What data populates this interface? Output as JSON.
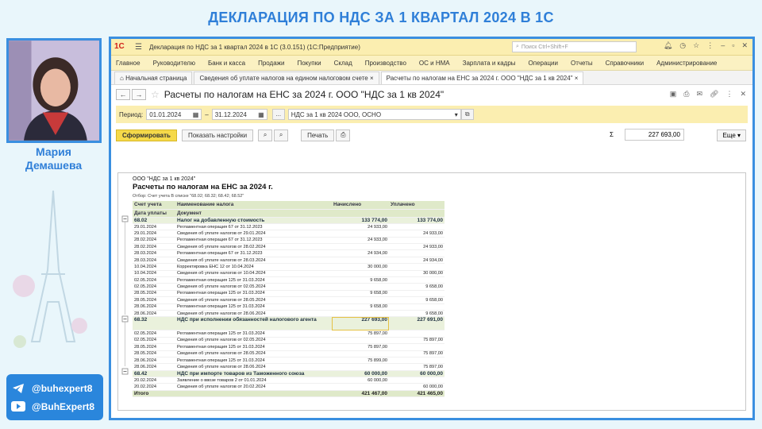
{
  "heading": "ДЕКЛАРАЦИЯ ПО НДС ЗА 1 КВАРТАЛ 2024 В 1С",
  "presenter": {
    "first_name": "Мария",
    "last_name": "Демашева"
  },
  "social": {
    "telegram": "@buhexpert8",
    "youtube": "@BuhExpert8"
  },
  "app": {
    "logo": "1С",
    "title": "Декларация по НДС за 1 квартал 2024 в 1С (3.0.151)  (1С:Предприятие)",
    "search_placeholder": "Поиск Ctrl+Shift+F"
  },
  "menu": [
    "Главное",
    "Руководителю",
    "Банк и касса",
    "Продажи",
    "Покупки",
    "Склад",
    "Производство",
    "ОС и НМА",
    "Зарплата и кадры",
    "Операции",
    "Отчеты",
    "Справочники",
    "Администрирование"
  ],
  "tabs": {
    "home": "Начальная страница",
    "t1": "Сведения об уплате налогов на едином налоговом счете",
    "t1_close": "×",
    "t2": "Расчеты по налогам на ЕНС за 2024 г. ООО \"НДС за 1 кв 2024\"",
    "t2_close": "×"
  },
  "form": {
    "title": "Расчеты по налогам на ЕНС за 2024 г. ООО \"НДС за 1 кв 2024\"",
    "period_label": "Период:",
    "date_from": "01.01.2024",
    "date_to": "31.12.2024",
    "dash": "–",
    "dots": "...",
    "org": "НДС за 1 кв 2024 ООО, ОСНО",
    "btn_generate": "Сформировать",
    "btn_settings": "Показать настройки",
    "btn_print": "Печать",
    "sum_symbol": "Σ",
    "sum_value": "227 693,00",
    "btn_more": "Еще ▾"
  },
  "report": {
    "org": "ООО \"НДС за 1 кв 2024\"",
    "title": "Расчеты по налогам на ЕНС за 2024 г.",
    "filter": "Отбор: Счет учета В списке \"68.02; 68.32; 68.42; 68.52\"",
    "headers": {
      "h1": "Счет учета",
      "h2": "Наименование налога",
      "h3": "Начислено",
      "h4": "Уплачено",
      "h5": "Дата уплаты",
      "h6": "Документ"
    },
    "rows": [
      {
        "type": "grp",
        "a": "68.02",
        "b": "Налог на добавленную стоимость",
        "c": "133 774,00",
        "d": "133 774,00"
      },
      {
        "type": "row",
        "a": "29.01.2024",
        "b": "Регламентная операция 67 от 31.12.2023",
        "c": "24 933,00",
        "d": ""
      },
      {
        "type": "row",
        "a": "29.01.2024",
        "b": "Сведения об уплате налогов от 29.01.2024",
        "c": "",
        "d": "24 933,00"
      },
      {
        "type": "row",
        "a": "28.02.2024",
        "b": "Регламентная операция 67 от 31.12.2023",
        "c": "24 933,00",
        "d": ""
      },
      {
        "type": "row",
        "a": "28.02.2024",
        "b": "Сведения об уплате налогов от 28.02.2024",
        "c": "",
        "d": "24 933,00"
      },
      {
        "type": "row",
        "a": "28.03.2024",
        "b": "Регламентная операция 67 от 31.12.2023",
        "c": "24 934,00",
        "d": ""
      },
      {
        "type": "row",
        "a": "28.03.2024",
        "b": "Сведения об уплате налогов от 28.03.2024",
        "c": "",
        "d": "24 934,00"
      },
      {
        "type": "row",
        "a": "10.04.2024",
        "b": "Корректировка ЕНС 12 от 10.04.2024",
        "c": "30 000,00",
        "d": ""
      },
      {
        "type": "row",
        "a": "10.04.2024",
        "b": "Сведения об уплате налогов от 10.04.2024",
        "c": "",
        "d": "30 000,00"
      },
      {
        "type": "row",
        "a": "02.05.2024",
        "b": "Регламентная операция 125 от 31.03.2024",
        "c": "9 658,00",
        "d": ""
      },
      {
        "type": "row",
        "a": "02.05.2024",
        "b": "Сведения об уплате налогов от 02.05.2024",
        "c": "",
        "d": "9 658,00"
      },
      {
        "type": "row",
        "a": "28.05.2024",
        "b": "Регламентная операция 125 от 31.03.2024",
        "c": "9 658,00",
        "d": ""
      },
      {
        "type": "row",
        "a": "28.05.2024",
        "b": "Сведения об уплате налогов от 28.05.2024",
        "c": "",
        "d": "9 658,00"
      },
      {
        "type": "row",
        "a": "28.06.2024",
        "b": "Регламентная операция 125 от 31.03.2024",
        "c": "9 658,00",
        "d": ""
      },
      {
        "type": "row",
        "a": "28.06.2024",
        "b": "Сведения об уплате налогов от 28.06.2024",
        "c": "",
        "d": "9 658,00"
      },
      {
        "type": "grp2",
        "a": "68.32",
        "b": "НДС при исполнении обязанностей налогового агента",
        "c": "227 693,00",
        "d": "227 691,00"
      },
      {
        "type": "row",
        "a": "02.05.2024",
        "b": "Регламентная операция 125 от 31.03.2024",
        "c": "75 897,00",
        "d": ""
      },
      {
        "type": "row",
        "a": "02.05.2024",
        "b": "Сведения об уплате налогов от 02.05.2024",
        "c": "",
        "d": "75 897,00"
      },
      {
        "type": "row",
        "a": "28.05.2024",
        "b": "Регламентная операция 125 от 31.03.2024",
        "c": "75 897,00",
        "d": ""
      },
      {
        "type": "row",
        "a": "28.05.2024",
        "b": "Сведения об уплате налогов от 28.05.2024",
        "c": "",
        "d": "75 897,00"
      },
      {
        "type": "row",
        "a": "28.06.2024",
        "b": "Регламентная операция 125 от 31.03.2024",
        "c": "75 899,00",
        "d": ""
      },
      {
        "type": "row",
        "a": "28.06.2024",
        "b": "Сведения об уплате налогов от 28.06.2024",
        "c": "",
        "d": "75 897,00"
      },
      {
        "type": "grp",
        "a": "68.42",
        "b": "НДС при импорте товаров из Таможенного союза",
        "c": "60 000,00",
        "d": "60 000,00"
      },
      {
        "type": "row",
        "a": "20.02.2024",
        "b": "Заявление о ввозе товаров 2 от 01.01.2024",
        "c": "60 000,00",
        "d": ""
      },
      {
        "type": "row",
        "a": "20.02.2024",
        "b": "Сведения об уплате налогов от 20.02.2024",
        "c": "",
        "d": "60 000,00"
      },
      {
        "type": "tot",
        "a": "Итого",
        "b": "",
        "c": "421 467,00",
        "d": "421 465,00"
      }
    ]
  }
}
